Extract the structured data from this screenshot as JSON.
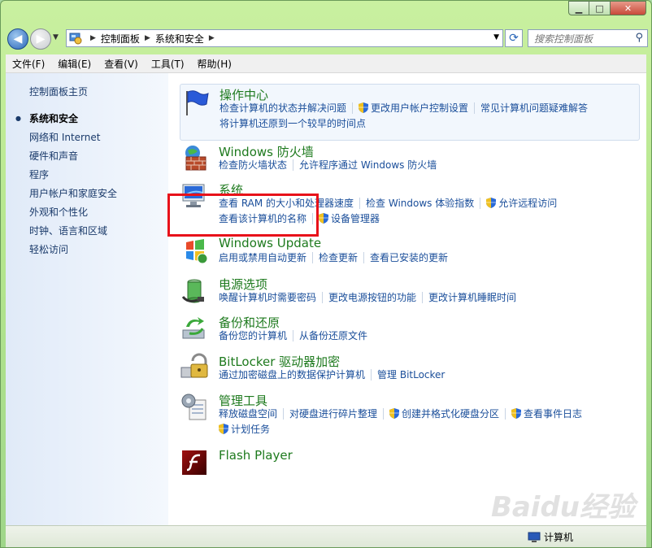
{
  "toolbar": {
    "breadcrumb": [
      "控制面板",
      "系统和安全"
    ],
    "search_placeholder": "搜索控制面板"
  },
  "menu": [
    "文件(F)",
    "编辑(E)",
    "查看(V)",
    "工具(T)",
    "帮助(H)"
  ],
  "sidebar": {
    "home": "控制面板主页",
    "items": [
      {
        "label": "系统和安全",
        "active": true
      },
      {
        "label": "网络和 Internet"
      },
      {
        "label": "硬件和声音"
      },
      {
        "label": "程序"
      },
      {
        "label": "用户帐户和家庭安全"
      },
      {
        "label": "外观和个性化"
      },
      {
        "label": "时钟、语言和区域"
      },
      {
        "label": "轻松访问"
      }
    ]
  },
  "categories": [
    {
      "title": "操作中心",
      "icon": "flag-icon",
      "lines": [
        [
          {
            "text": "检查计算机的状态并解决问题"
          },
          {
            "text": "更改用户帐户控制设置",
            "shield": true
          },
          {
            "text": "常见计算机问题疑难解答"
          }
        ],
        [
          {
            "text": "将计算机还原到一个较早的时间点"
          }
        ]
      ]
    },
    {
      "title": "Windows 防火墙",
      "icon": "firewall-icon",
      "lines": [
        [
          {
            "text": "检查防火墙状态"
          },
          {
            "text": "允许程序通过 Windows 防火墙"
          }
        ]
      ]
    },
    {
      "title": "系统",
      "icon": "system-computer-icon",
      "lines": [
        [
          {
            "text": "查看 RAM 的大小和处理器速度"
          },
          {
            "text": "检查 Windows 体验指数"
          },
          {
            "text": "允许远程访问",
            "shield": true
          }
        ],
        [
          {
            "text": "查看该计算机的名称"
          },
          {
            "text": "设备管理器",
            "shield": true
          }
        ]
      ]
    },
    {
      "title": "Windows Update",
      "icon": "windows-update-icon",
      "lines": [
        [
          {
            "text": "启用或禁用自动更新"
          },
          {
            "text": "检查更新"
          },
          {
            "text": "查看已安装的更新"
          }
        ]
      ]
    },
    {
      "title": "电源选项",
      "icon": "power-battery-icon",
      "lines": [
        [
          {
            "text": "唤醒计算机时需要密码"
          },
          {
            "text": "更改电源按钮的功能"
          },
          {
            "text": "更改计算机睡眠时间"
          }
        ]
      ]
    },
    {
      "title": "备份和还原",
      "icon": "backup-restore-icon",
      "lines": [
        [
          {
            "text": "备份您的计算机"
          },
          {
            "text": "从备份还原文件"
          }
        ]
      ]
    },
    {
      "title": "BitLocker 驱动器加密",
      "icon": "bitlocker-icon",
      "lines": [
        [
          {
            "text": "通过加密磁盘上的数据保护计算机"
          },
          {
            "text": "管理 BitLocker"
          }
        ]
      ]
    },
    {
      "title": "管理工具",
      "icon": "admin-tools-icon",
      "lines": [
        [
          {
            "text": "释放磁盘空间"
          },
          {
            "text": "对硬盘进行碎片整理"
          },
          {
            "text": "创建并格式化硬盘分区",
            "shield": true
          },
          {
            "text": "查看事件日志",
            "shield": true
          }
        ],
        [
          {
            "text": "计划任务",
            "shield": true
          }
        ]
      ]
    },
    {
      "title": "Flash Player",
      "icon": "flash-player-icon",
      "lines": []
    }
  ],
  "statusbar": {
    "computer": "计算机"
  },
  "watermark": "Baidu经验",
  "colors": {
    "link": "#1a4e9a",
    "title": "#1e7a1e",
    "highlight": "#e8121a"
  }
}
